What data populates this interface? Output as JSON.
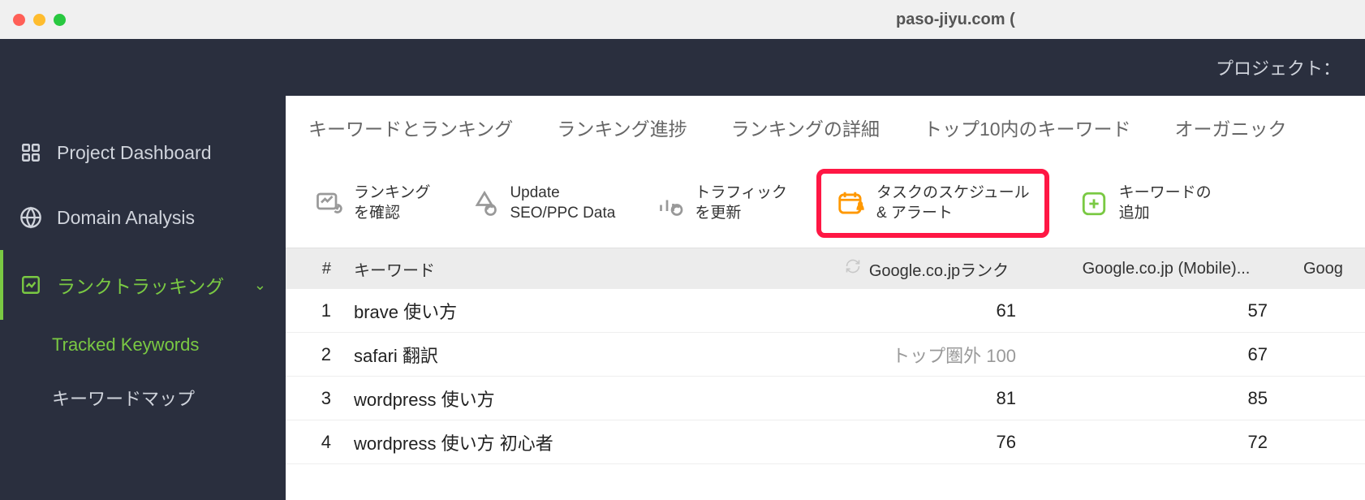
{
  "window": {
    "title": "paso-jiyu.com ("
  },
  "topbar": {
    "project_label": "プロジェクト："
  },
  "sidebar": {
    "dashboard": "Project Dashboard",
    "domain": "Domain Analysis",
    "rank": "ランクトラッキング",
    "sub": {
      "tracked": "Tracked Keywords",
      "kwmap": "キーワードマップ"
    }
  },
  "tabs": {
    "t1": "キーワードとランキング",
    "t2": "ランキング進捗",
    "t3": "ランキングの詳細",
    "t4": "トップ10内のキーワード",
    "t5": "オーガニック"
  },
  "toolbar": {
    "checkrank_l1": "ランキング",
    "checkrank_l2": "を確認",
    "update_l1": "Update",
    "update_l2": "SEO/PPC Data",
    "traffic_l1": "トラフィック",
    "traffic_l2": "を更新",
    "sched_l1": "タスクのスケジュール",
    "sched_l2": "& アラート",
    "addkw_l1": "キーワードの",
    "addkw_l2": "追加"
  },
  "columns": {
    "num": "#",
    "kw": "キーワード",
    "rank": "Google.co.jpランク",
    "mobile": "Google.co.jp (Mobile)...",
    "last": "Goog"
  },
  "rows": [
    {
      "n": "1",
      "kw": "brave 使い方",
      "rank": "61",
      "mob": "57"
    },
    {
      "n": "2",
      "kw": "safari 翻訳",
      "rank": "トップ圏外 100",
      "rank_oor": true,
      "mob": "67"
    },
    {
      "n": "3",
      "kw": "wordpress 使い方",
      "rank": "81",
      "mob": "85"
    },
    {
      "n": "4",
      "kw": "wordpress 使い方 初心者",
      "rank": "76",
      "mob": "72"
    }
  ]
}
